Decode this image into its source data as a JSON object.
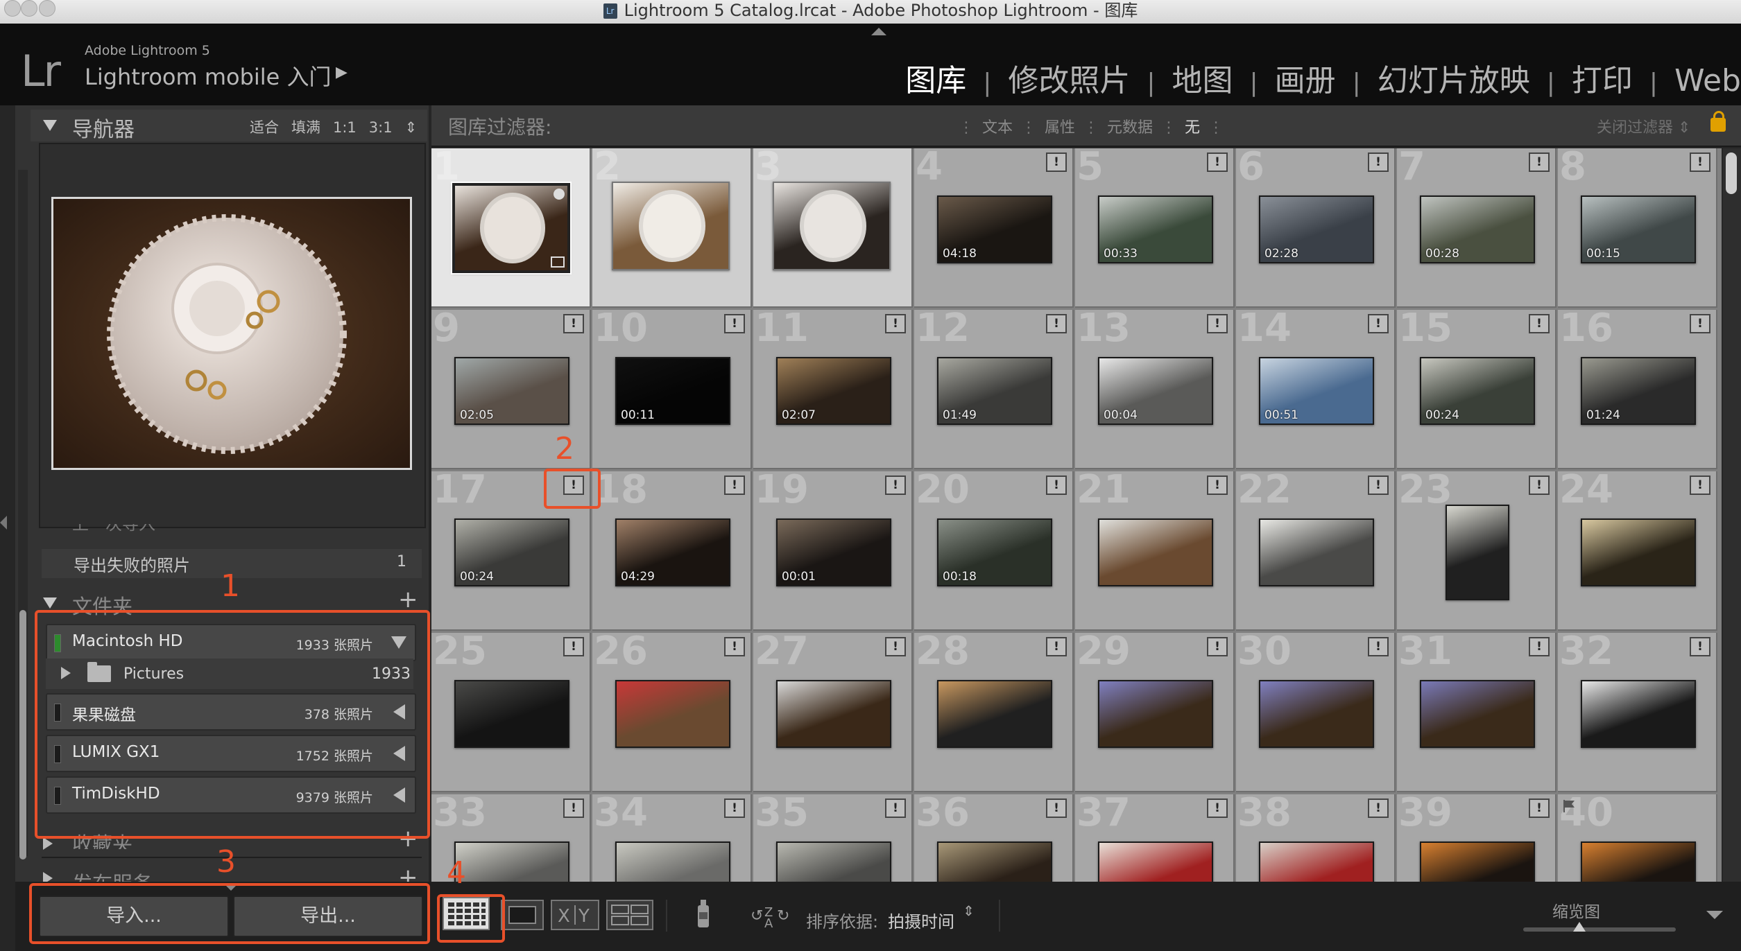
{
  "window": {
    "title": "Lightroom 5 Catalog.lrcat - Adobe Photoshop Lightroom - 图库",
    "app_badge": "Lr"
  },
  "header": {
    "logo": "Lr",
    "brand": "Adobe Lightroom 5",
    "mobile_label": "Lightroom mobile 入门",
    "mobile_arrow": "▶",
    "modules": [
      {
        "label": "图库",
        "active": true
      },
      {
        "label": "修改照片",
        "active": false
      },
      {
        "label": "地图",
        "active": false
      },
      {
        "label": "画册",
        "active": false
      },
      {
        "label": "幻灯片放映",
        "active": false
      },
      {
        "label": "打印",
        "active": false
      },
      {
        "label": "Web",
        "active": false
      }
    ],
    "separator": "|"
  },
  "navigator": {
    "title": "导航器",
    "options": [
      "适合",
      "填满",
      "1:1",
      "3:1"
    ],
    "stepper": "⇕"
  },
  "catalog": {
    "partial_item": "上一次导入",
    "export_failed_label": "导出失败的照片",
    "export_failed_count": "1"
  },
  "folders": {
    "title": "文件夹",
    "add": "+",
    "volumes": [
      {
        "name": "Macintosh HD",
        "count": "1933 张照片",
        "expanded": true
      },
      {
        "name": "果果磁盘",
        "count": "378 张照片",
        "expanded": false
      },
      {
        "name": "LUMIX GX1",
        "count": "1752 张照片",
        "expanded": false
      },
      {
        "name": "TimDiskHD",
        "count": "9379 张照片",
        "expanded": false
      }
    ],
    "subfolder": {
      "name": "Pictures",
      "count": "1933"
    }
  },
  "collections": {
    "title": "收藏夹",
    "add": "+"
  },
  "publish": {
    "title": "发布服务",
    "add": "+"
  },
  "buttons": {
    "import": "导入...",
    "export": "导出..."
  },
  "toolbar": {
    "sort_label": "排序依据:",
    "sort_value": "拍摄时间",
    "sort_stepper": "⇕",
    "thumb_label": "缩览图",
    "sort_icon": "↻"
  },
  "filter": {
    "title": "图库过滤器:",
    "options": [
      "文本",
      "属性",
      "元数据"
    ],
    "none": "无",
    "close": "关闭过滤器 ⇕",
    "sep": "⋮"
  },
  "grid": {
    "badge": "!",
    "cells": [
      {
        "n": "1",
        "type": "selected",
        "dur": "",
        "colors": [
          "#3a2618",
          "#e8e2dc"
        ]
      },
      {
        "n": "2",
        "type": "selected2",
        "dur": "",
        "colors": [
          "#7a5a3a",
          "#f0ece6"
        ]
      },
      {
        "n": "3",
        "type": "selected2",
        "dur": "",
        "colors": [
          "#2a2420",
          "#e8e4e0"
        ]
      },
      {
        "n": "4",
        "type": "video",
        "dur": "04:18",
        "colors": [
          "#1a1612",
          "#6a5a4a"
        ]
      },
      {
        "n": "5",
        "type": "video",
        "dur": "00:33",
        "colors": [
          "#3a4a3a",
          "#c8ccc8"
        ]
      },
      {
        "n": "6",
        "type": "video",
        "dur": "02:28",
        "colors": [
          "#3a4048",
          "#8a9098"
        ]
      },
      {
        "n": "7",
        "type": "video",
        "dur": "00:28",
        "colors": [
          "#4a5040",
          "#c0c4c0"
        ]
      },
      {
        "n": "8",
        "type": "video",
        "dur": "00:15",
        "colors": [
          "#404848",
          "#b8c0c0"
        ]
      },
      {
        "n": "9",
        "type": "video",
        "dur": "02:05",
        "colors": [
          "#5a5048",
          "#a0a8a8"
        ]
      },
      {
        "n": "10",
        "type": "video",
        "dur": "00:11",
        "colors": [
          "#050505",
          "#101010"
        ]
      },
      {
        "n": "11",
        "type": "video",
        "dur": "02:07",
        "colors": [
          "#2a2018",
          "#a08058"
        ]
      },
      {
        "n": "12",
        "type": "video",
        "dur": "01:49",
        "colors": [
          "#3a3a38",
          "#a8a8a0"
        ]
      },
      {
        "n": "13",
        "type": "video",
        "dur": "00:04",
        "colors": [
          "#5a5a58",
          "#e8e8e8"
        ]
      },
      {
        "n": "14",
        "type": "video",
        "dur": "00:51",
        "colors": [
          "#4a6a90",
          "#c8d4e0"
        ]
      },
      {
        "n": "15",
        "type": "video",
        "dur": "00:24",
        "colors": [
          "#3a4038",
          "#c8c8c0"
        ]
      },
      {
        "n": "16",
        "type": "video",
        "dur": "01:24",
        "colors": [
          "#2a2a2a",
          "#9a9a90"
        ]
      },
      {
        "n": "17",
        "type": "video",
        "dur": "00:24",
        "colors": [
          "#3a3a38",
          "#b0b0a8"
        ]
      },
      {
        "n": "18",
        "type": "video",
        "dur": "04:29",
        "colors": [
          "#1a1410",
          "#a08068"
        ]
      },
      {
        "n": "19",
        "type": "video",
        "dur": "00:01",
        "colors": [
          "#1a1614",
          "#7a6a5a"
        ]
      },
      {
        "n": "20",
        "type": "video",
        "dur": "00:18",
        "colors": [
          "#2a3028",
          "#8a9088"
        ]
      },
      {
        "n": "21",
        "type": "photo",
        "dur": "",
        "colors": [
          "#6a4a30",
          "#e0e0dc"
        ]
      },
      {
        "n": "22",
        "type": "photo",
        "dur": "",
        "colors": [
          "#4a4a48",
          "#e8e8e4"
        ]
      },
      {
        "n": "23",
        "type": "portrait",
        "dur": "",
        "colors": [
          "#202020",
          "#d8d8d0"
        ]
      },
      {
        "n": "24",
        "type": "photo",
        "dur": "",
        "colors": [
          "#2a2418",
          "#d8c8a0"
        ]
      },
      {
        "n": "25",
        "type": "photo",
        "dur": "",
        "colors": [
          "#141414",
          "#4a4a48"
        ]
      },
      {
        "n": "26",
        "type": "photo",
        "dur": "",
        "colors": [
          "#6a4a30",
          "#c83838"
        ]
      },
      {
        "n": "27",
        "type": "photo",
        "dur": "",
        "colors": [
          "#3a2818",
          "#d8d8d8"
        ]
      },
      {
        "n": "28",
        "type": "photo",
        "dur": "",
        "colors": [
          "#202020",
          "#c89860"
        ]
      },
      {
        "n": "29",
        "type": "photo",
        "dur": "",
        "colors": [
          "#3a2a1a",
          "#8080c0"
        ]
      },
      {
        "n": "30",
        "type": "photo",
        "dur": "",
        "colors": [
          "#3a2a1a",
          "#8080c0"
        ]
      },
      {
        "n": "31",
        "type": "photo",
        "dur": "",
        "colors": [
          "#3a2a1a",
          "#7a7ab8"
        ]
      },
      {
        "n": "32",
        "type": "photo",
        "dur": "",
        "colors": [
          "#1a1a1a",
          "#e8e8e8"
        ]
      },
      {
        "n": "33",
        "type": "photo",
        "dur": "",
        "colors": [
          "#5a5a58",
          "#d0d0c8"
        ]
      },
      {
        "n": "34",
        "type": "photo",
        "dur": "",
        "colors": [
          "#6a6a68",
          "#c8c8c0"
        ]
      },
      {
        "n": "35",
        "type": "photo",
        "dur": "",
        "colors": [
          "#4a4a48",
          "#b8b8b0"
        ]
      },
      {
        "n": "36",
        "type": "photo",
        "dur": "",
        "colors": [
          "#2a2018",
          "#a89878"
        ]
      },
      {
        "n": "37",
        "type": "photo",
        "dur": "",
        "colors": [
          "#a02020",
          "#e8e0d8"
        ]
      },
      {
        "n": "38",
        "type": "photo",
        "dur": "",
        "colors": [
          "#a02020",
          "#d8d0c8"
        ]
      },
      {
        "n": "39",
        "type": "photo",
        "dur": "",
        "colors": [
          "#1a1410",
          "#d88030"
        ]
      },
      {
        "n": "40",
        "type": "photo",
        "dur": "",
        "colors": [
          "#1a1410",
          "#d88030"
        ]
      }
    ]
  },
  "annotations": [
    "1",
    "2",
    "3",
    "4"
  ],
  "colors": {
    "accent": "#e8502a",
    "panel": "#333333",
    "grid": "#a7a7a7"
  }
}
